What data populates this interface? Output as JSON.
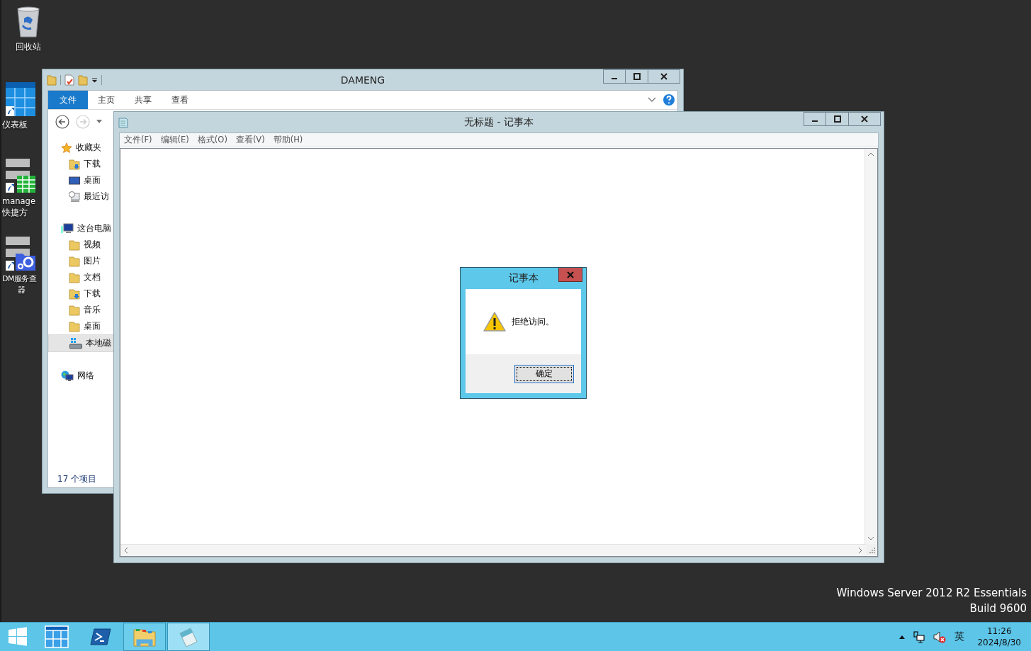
{
  "desktop_icons": [
    {
      "kind": "recycle-bin",
      "lines": [
        "回收站"
      ]
    },
    {
      "kind": "dashboard",
      "lines": [
        "仪表板"
      ]
    },
    {
      "kind": "grid-shortcut",
      "lines": [
        "manage",
        "快捷方"
      ]
    },
    {
      "kind": "service-shortcut",
      "lines": [
        "DM服务查",
        "器"
      ]
    }
  ],
  "explorer": {
    "title": "DAMENG",
    "ribbon_tabs": [
      {
        "label": "文件",
        "selected": true
      },
      {
        "label": "主页",
        "selected": false
      },
      {
        "label": "共享",
        "selected": false
      },
      {
        "label": "查看",
        "selected": false
      }
    ],
    "nav_tree": [
      {
        "label": "收藏夹",
        "kind": "star",
        "selected": false,
        "children": [
          {
            "label": "下载",
            "kind": "folder-download",
            "selected": false
          },
          {
            "label": "桌面",
            "kind": "monitor",
            "selected": false
          },
          {
            "label": "最近访",
            "kind": "recent",
            "selected": false
          }
        ]
      },
      {
        "label": "这台电脑",
        "kind": "computer",
        "selected": false,
        "children": [
          {
            "label": "视频",
            "kind": "folder",
            "selected": false
          },
          {
            "label": "图片",
            "kind": "folder",
            "selected": false
          },
          {
            "label": "文档",
            "kind": "folder",
            "selected": false
          },
          {
            "label": "下载",
            "kind": "folder-download",
            "selected": false
          },
          {
            "label": "音乐",
            "kind": "folder",
            "selected": false
          },
          {
            "label": "桌面",
            "kind": "folder",
            "selected": false
          },
          {
            "label": "本地磁",
            "kind": "drive",
            "selected": true
          }
        ]
      },
      {
        "label": "网络",
        "kind": "network",
        "selected": false
      }
    ],
    "status": "17 个项目"
  },
  "notepad": {
    "title": "无标题 - 记事本",
    "menu": [
      "文件(F)",
      "编辑(E)",
      "格式(O)",
      "查看(V)",
      "帮助(H)"
    ]
  },
  "dialog": {
    "title": "记事本",
    "message": "拒绝访问。",
    "button": {
      "label": "确定",
      "focused": true
    }
  },
  "os_watermark": [
    "Windows Server 2012 R2 Essentials",
    "Build 9600"
  ],
  "taskbar": {
    "apps": [
      {
        "kind": "start",
        "running": false,
        "selected": false
      },
      {
        "kind": "dashboard",
        "running": false,
        "selected": false
      },
      {
        "kind": "powershell",
        "running": false,
        "selected": false
      },
      {
        "kind": "explorer",
        "running": true,
        "selected": false
      },
      {
        "kind": "notepad",
        "running": true,
        "selected": true
      }
    ],
    "tray": {
      "volume_muted": true,
      "input_method": "英",
      "time": "11:26",
      "date": "2024/8/30"
    }
  }
}
